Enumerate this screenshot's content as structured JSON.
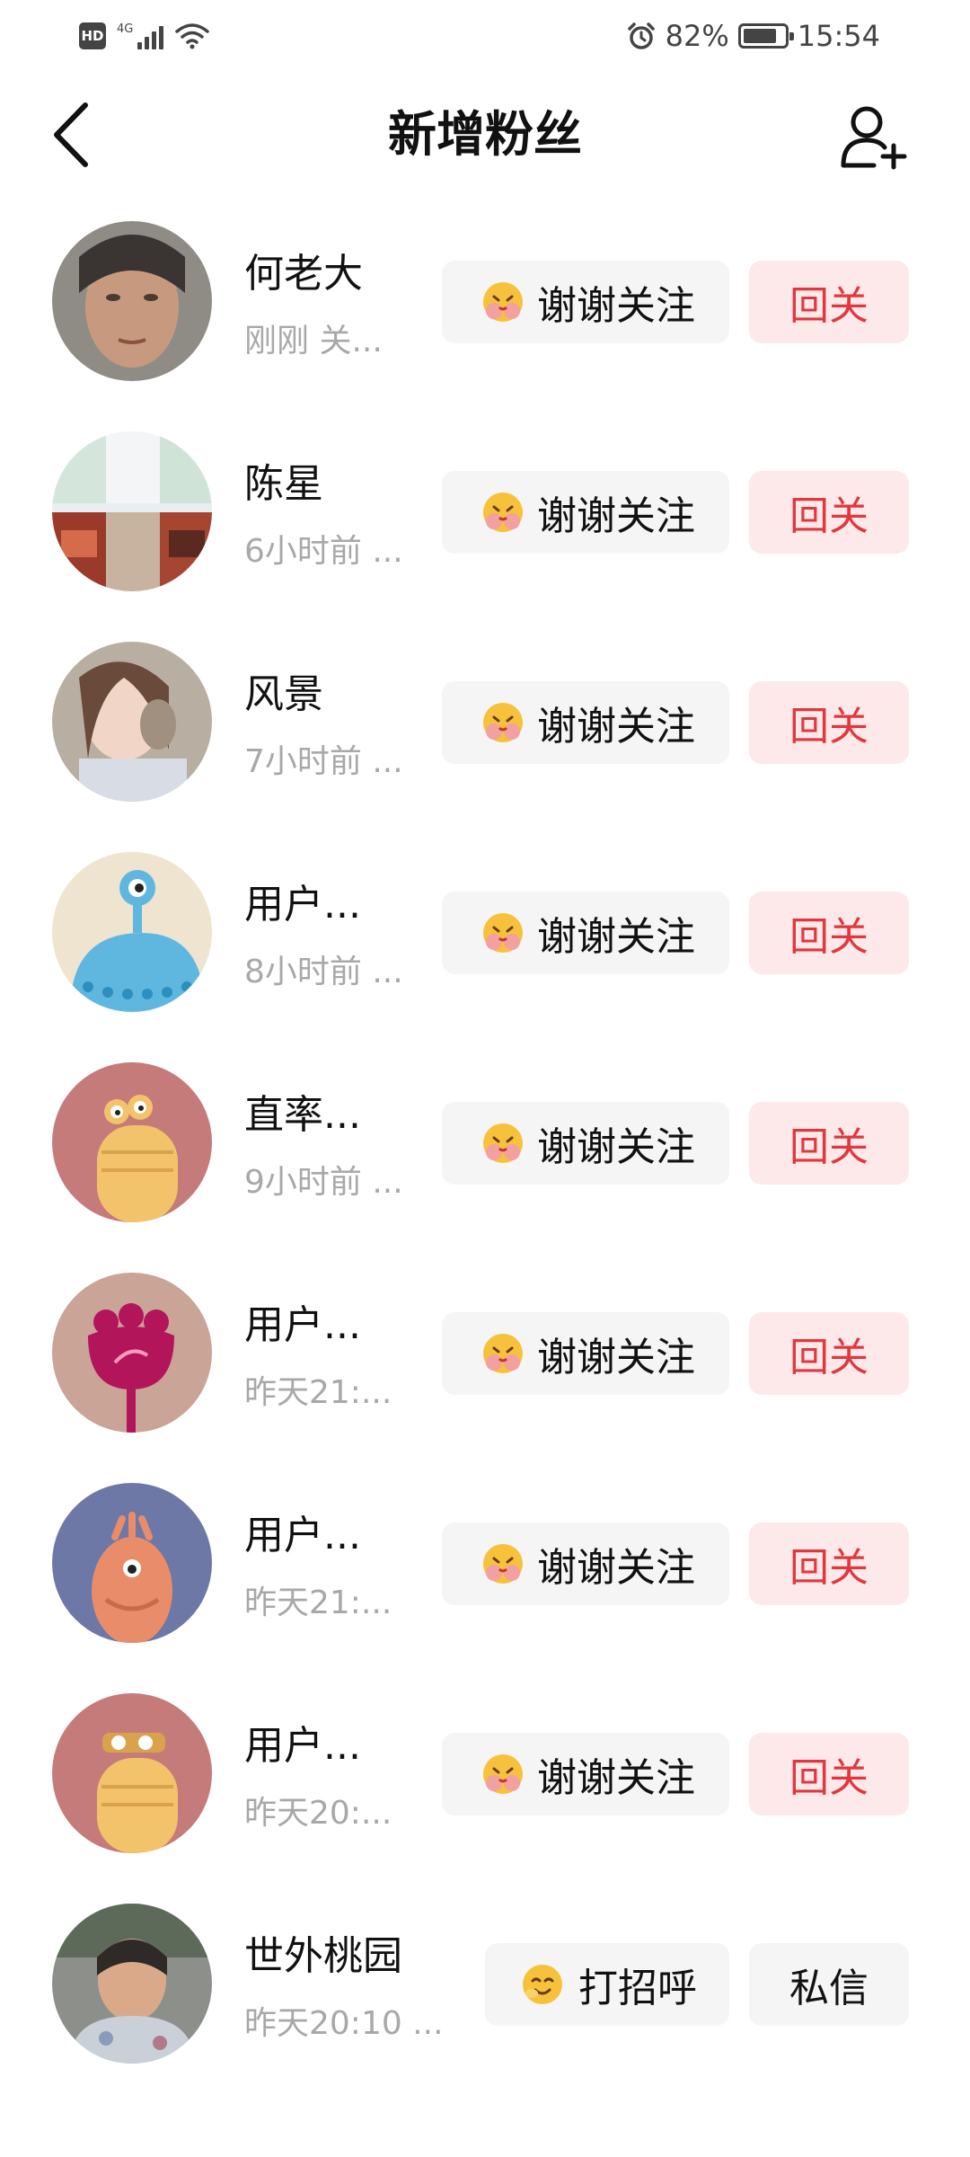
{
  "status_bar": {
    "hd_label": "HD",
    "network_label": "4G",
    "battery_percent": "82%",
    "battery_level": 0.82,
    "time": "15:54"
  },
  "header": {
    "title": "新增粉丝",
    "back_icon": "chevron-left-icon",
    "add_friend_icon": "add-user-icon"
  },
  "fans": [
    {
      "name": "何老大",
      "sub": "刚刚 关...",
      "action": "谢谢关注",
      "action2": "回关"
    },
    {
      "name": "陈星",
      "sub": "6小时前 ...",
      "action": "谢谢关注",
      "action2": "回关"
    },
    {
      "name": "风景",
      "sub": "7小时前 ...",
      "action": "谢谢关注",
      "action2": "回关"
    },
    {
      "name": "用户...",
      "sub": "8小时前 ...",
      "action": "谢谢关注",
      "action2": "回关"
    },
    {
      "name": "直率...",
      "sub": "9小时前 ...",
      "action": "谢谢关注",
      "action2": "回关"
    },
    {
      "name": "用户...",
      "sub": "昨天21:...",
      "action": "谢谢关注",
      "action2": "回关"
    },
    {
      "name": "用户...",
      "sub": "昨天21:...",
      "action": "谢谢关注",
      "action2": "回关"
    },
    {
      "name": "用户...",
      "sub": "昨天20:...",
      "action": "谢谢关注",
      "action2": "回关"
    },
    {
      "name": "世外桃园",
      "sub": "昨天20:10 ...",
      "action": "打招呼",
      "action2": "私信"
    }
  ],
  "colors": {
    "accent_red": "#e0383e",
    "follow_bg": "#fde9e9",
    "button_bg": "#f5f5f5",
    "secondary_text": "#a8a8a8"
  }
}
